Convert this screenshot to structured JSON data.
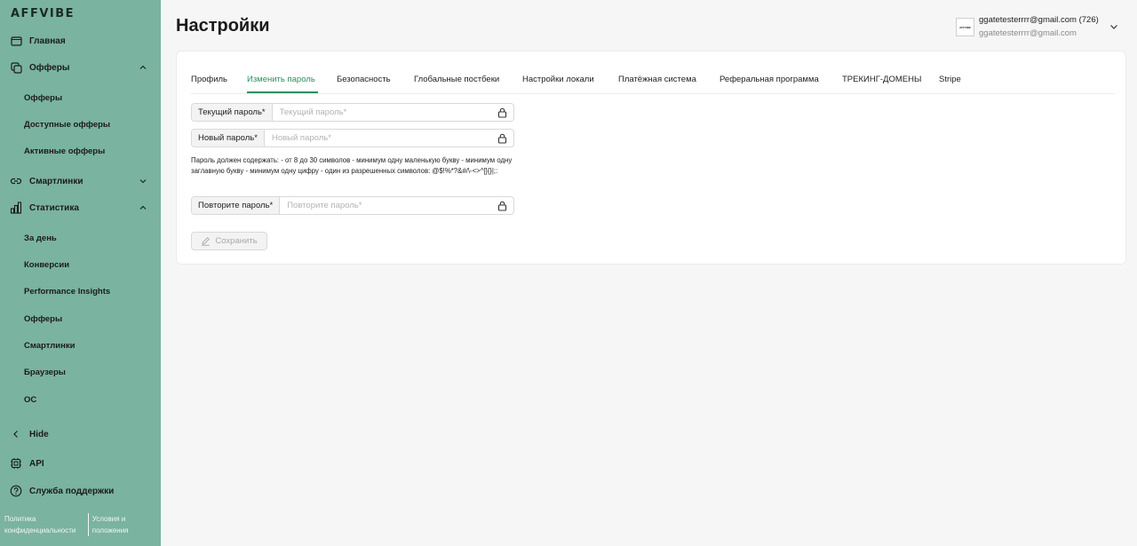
{
  "brand": {
    "logo": "AFFVIBE"
  },
  "sidebar": {
    "main": "Главная",
    "offers": {
      "label": "Офферы",
      "items": [
        "Офферы",
        "Доступные офферы",
        "Активные офферы"
      ]
    },
    "smartlinks": "Смартлинки",
    "stats": {
      "label": "Статистика",
      "items": [
        "За день",
        "Конверсии",
        "Performance Insights",
        "Офферы",
        "Смартлинки",
        "Браузеры",
        "ОС"
      ]
    },
    "hide": "Hide",
    "api": "API",
    "support": "Служба поддержки",
    "footer": {
      "privacy": "Политика конфиденциальности",
      "terms": "Условия и положения"
    }
  },
  "header": {
    "title": "Настройки",
    "user_email_count": "ggatetesterrrr@gmail.com (726)",
    "user_email": "ggatetesterrrr@gmail.com",
    "user_logo": "AFFVIBE"
  },
  "tabs": [
    "Профиль",
    "Изменить пароль",
    "Безопасность",
    "Глобальные постбеки",
    "Настройки локали",
    "Платёжная система",
    "Реферальная программа",
    "ТРЕКИНГ-ДОМЕНЫ",
    "Stripe"
  ],
  "form": {
    "current": {
      "label": "Текущий пароль*",
      "placeholder": "Текущий пароль*"
    },
    "new": {
      "label": "Новый пароль*",
      "placeholder": "Новый пароль*"
    },
    "hint": "Пароль должен содержать: - от 8 до 30 символов - минимум одну маленькую букву - минимум одну заглавную букву - минимум одну цифру - один из разрешенных символов: @$!%*?&#/\\-<>^[]{}|;:",
    "repeat": {
      "label": "Повторите пароль*",
      "placeholder": "Повторите пароль*"
    },
    "save": "Сохранить"
  },
  "colors": {
    "sidebar": "#7ab3a0",
    "accent": "#2e8f5e"
  }
}
